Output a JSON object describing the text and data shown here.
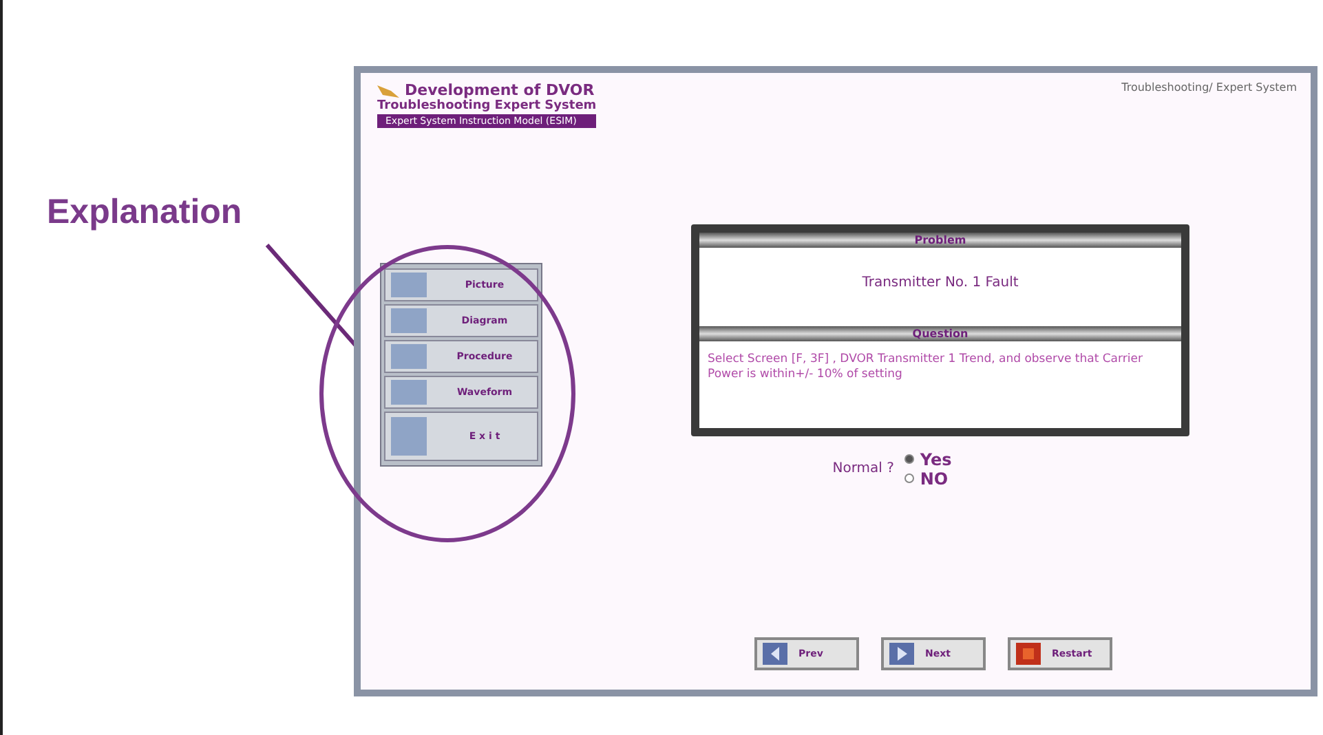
{
  "annotation": {
    "label": "Explanation"
  },
  "window": {
    "title_lines": [
      "Development of DVOR",
      "Troubleshooting  Expert  System"
    ],
    "subtitle": "Expert System Instruction Model (ESIM)",
    "caption": "Troubleshooting/ Expert System"
  },
  "menu": [
    {
      "label": "Picture"
    },
    {
      "label": "Diagram"
    },
    {
      "label": "Procedure"
    },
    {
      "label": "Waveform"
    },
    {
      "label": "E x i t"
    }
  ],
  "problem": {
    "heading": "Problem",
    "text": "Transmitter No. 1 Fault"
  },
  "question": {
    "heading": "Question",
    "text": "Select Screen [F, 3F] , DVOR Transmitter 1 Trend, and observe that Carrier Power is within+/- 10% of setting"
  },
  "answer": {
    "label": "Normal ?",
    "options": [
      {
        "label": "Yes",
        "selected": true
      },
      {
        "label": "NO",
        "selected": false
      }
    ]
  },
  "nav_buttons": [
    {
      "label": "Prev",
      "kind": "prev"
    },
    {
      "label": "Next",
      "kind": "next"
    },
    {
      "label": "Restart",
      "kind": "restart"
    }
  ]
}
